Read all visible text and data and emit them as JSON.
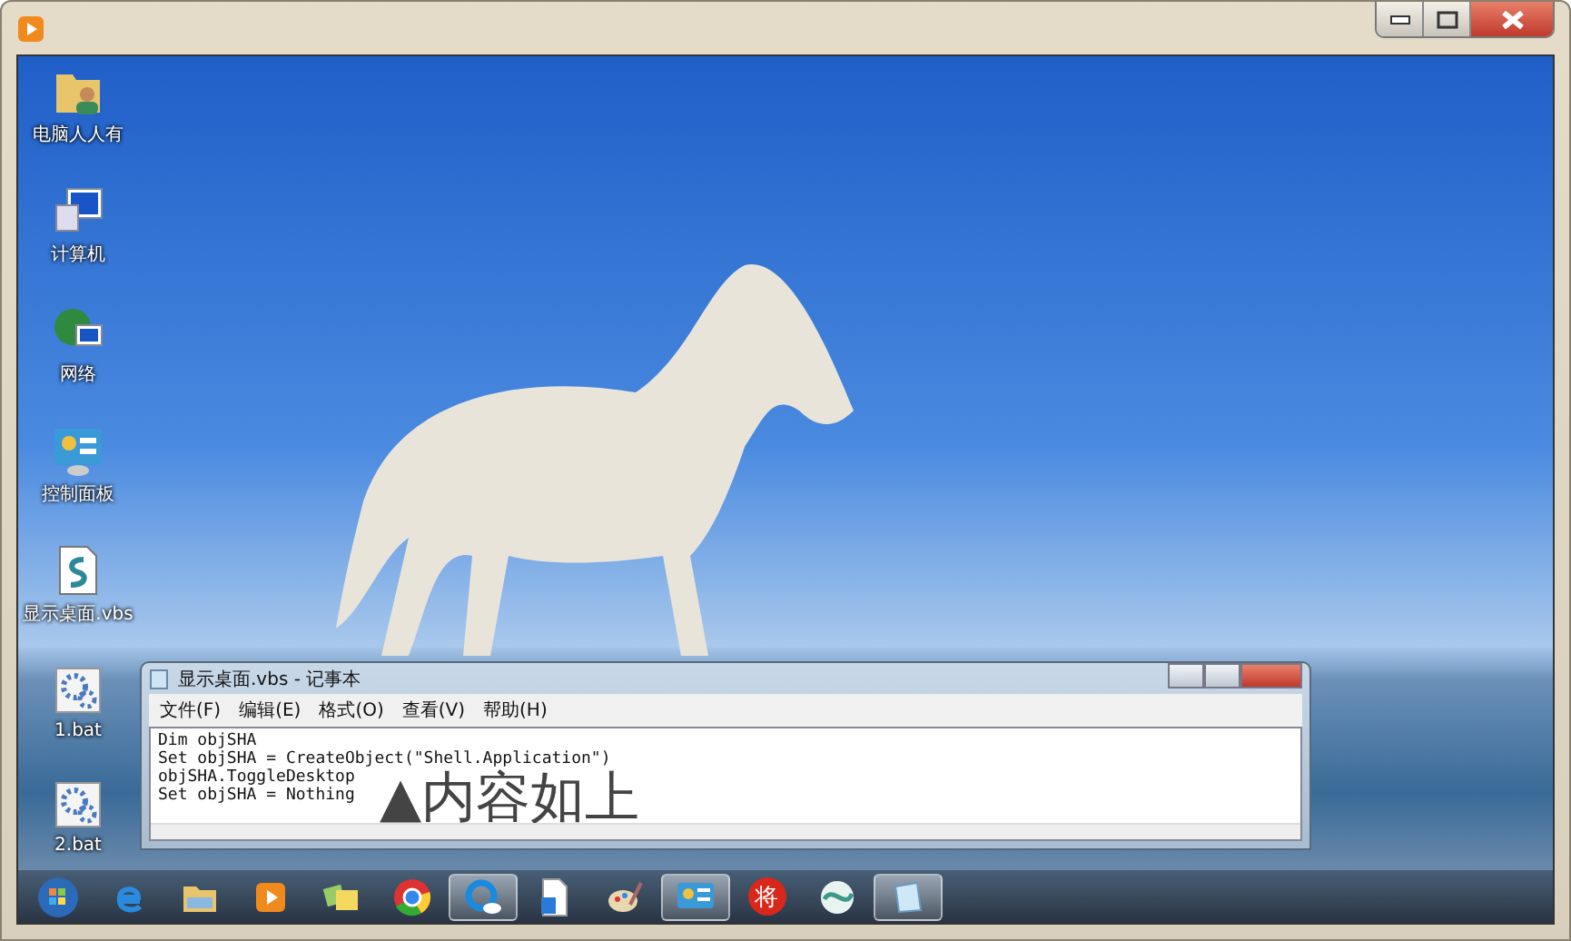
{
  "desktop_icons": [
    {
      "kind": "user-folder",
      "label": "电脑人人有"
    },
    {
      "kind": "computer",
      "label": "计算机"
    },
    {
      "kind": "network",
      "label": "网络"
    },
    {
      "kind": "control-panel",
      "label": "控制面板"
    },
    {
      "kind": "script",
      "label": "显示桌面.vbs"
    },
    {
      "kind": "batch",
      "label": "1.bat"
    },
    {
      "kind": "batch",
      "label": "2.bat"
    }
  ],
  "notepad": {
    "title": "显示桌面.vbs - 记事本",
    "menu": [
      "文件(F)",
      "编辑(E)",
      "格式(O)",
      "查看(V)",
      "帮助(H)"
    ],
    "lines": [
      "Dim objSHA",
      "Set objSHA = CreateObject(\"Shell.Application\")",
      "objSHA.ToggleDesktop",
      "Set objSHA = Nothing"
    ]
  },
  "caption": "▲内容如上",
  "taskbar": [
    {
      "kind": "start",
      "active": false
    },
    {
      "kind": "ie",
      "active": false
    },
    {
      "kind": "explorer",
      "active": false
    },
    {
      "kind": "media",
      "active": false
    },
    {
      "kind": "notes",
      "active": false
    },
    {
      "kind": "chrome",
      "active": false
    },
    {
      "kind": "cloud-browser",
      "active": true
    },
    {
      "kind": "document",
      "active": false
    },
    {
      "kind": "paint",
      "active": false
    },
    {
      "kind": "control-panel",
      "active": true
    },
    {
      "kind": "badge",
      "label": "将",
      "active": false
    },
    {
      "kind": "swirl",
      "active": false
    },
    {
      "kind": "notepad",
      "active": true
    }
  ]
}
